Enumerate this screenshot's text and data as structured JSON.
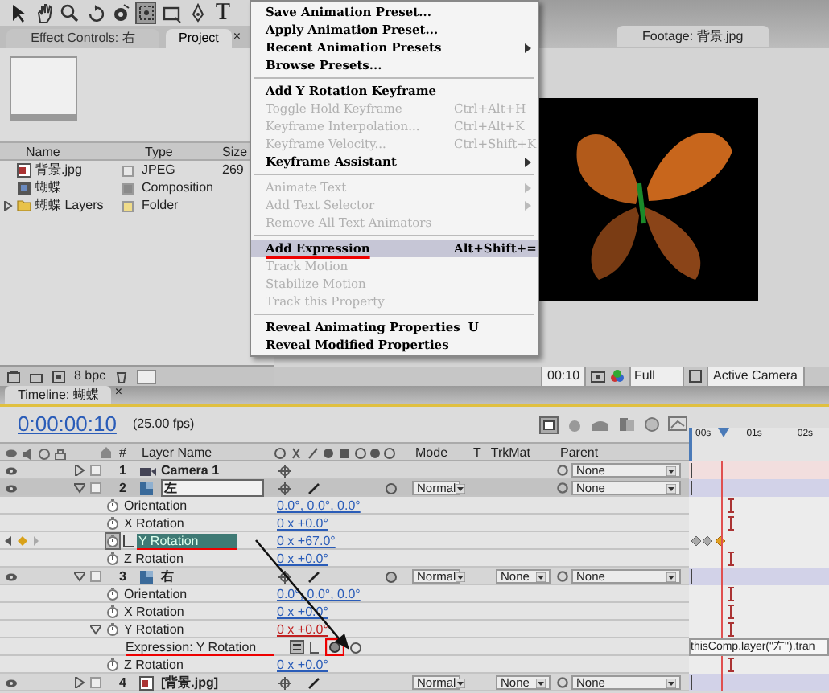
{
  "tools": [
    {
      "kind": "selection",
      "selected": false
    },
    {
      "kind": "hand",
      "selected": false
    },
    {
      "kind": "zoom",
      "selected": false
    },
    {
      "kind": "rotate",
      "selected": false
    },
    {
      "kind": "orbit",
      "selected": false
    },
    {
      "kind": "pan-behind",
      "selected": true
    },
    {
      "kind": "rectangle",
      "selected": false
    },
    {
      "kind": "pen",
      "selected": false
    },
    {
      "kind": "text",
      "label": "T",
      "selected": false
    }
  ],
  "left_panel": {
    "tabs": [
      {
        "label": "Effect Controls: 右",
        "selected": false
      },
      {
        "label": "Project",
        "close": "×",
        "selected": true
      }
    ],
    "columns": [
      "Name",
      "Type",
      "Size"
    ],
    "items": [
      {
        "kind": "footage",
        "name": "背景.jpg",
        "type": "JPEG",
        "size": "269"
      },
      {
        "kind": "composition",
        "name": "蝴蝶",
        "type": "Composition"
      },
      {
        "kind": "folder",
        "name": "蝴蝶 Layers",
        "type": "Folder",
        "expanded": false
      }
    ],
    "bit_depth": "8 bpc"
  },
  "context_menu": {
    "groups": [
      [
        {
          "label": "Save Animation Preset...",
          "disabled": false,
          "selected": false
        },
        {
          "label": "Apply Animation Preset...",
          "disabled": false,
          "selected": false
        },
        {
          "label": "Recent Animation Presets",
          "disabled": false,
          "submenu": true,
          "selected": false
        },
        {
          "label": "Browse Presets...",
          "disabled": false,
          "selected": false
        }
      ],
      [
        {
          "label": "Add Y Rotation Keyframe",
          "disabled": false,
          "selected": false
        },
        {
          "label": "Toggle Hold Keyframe",
          "shortcut": "Ctrl+Alt+H",
          "disabled": true,
          "selected": false
        },
        {
          "label": "Keyframe Interpolation...",
          "shortcut": "Ctrl+Alt+K",
          "disabled": true,
          "selected": false
        },
        {
          "label": "Keyframe Velocity...",
          "shortcut": "Ctrl+Shift+K",
          "disabled": true,
          "selected": false
        },
        {
          "label": "Keyframe Assistant",
          "disabled": false,
          "submenu": true,
          "selected": false
        }
      ],
      [
        {
          "label": "Animate Text",
          "disabled": true,
          "submenu": true,
          "selected": false
        },
        {
          "label": "Add Text Selector",
          "disabled": true,
          "submenu": true,
          "selected": false
        },
        {
          "label": "Remove All Text Animators",
          "disabled": true,
          "selected": false
        }
      ],
      [
        {
          "label": "Add Expression",
          "shortcut": "Alt+Shift+=",
          "disabled": false,
          "selected": true,
          "underlined": true
        },
        {
          "label": "Track Motion",
          "disabled": true,
          "selected": false
        },
        {
          "label": "Stabilize Motion",
          "disabled": true,
          "selected": false
        },
        {
          "label": "Track this Property",
          "disabled": true,
          "selected": false
        }
      ],
      [
        {
          "label": "Reveal Animating Properties",
          "shortcut": "U",
          "disabled": false,
          "selected": false
        },
        {
          "label": "Reveal Modified Properties",
          "disabled": false,
          "selected": false
        }
      ]
    ]
  },
  "viewer": {
    "tab": "Footage: 背景.jpg",
    "time": "00:10",
    "resolution": "Full",
    "view": "Active Camera"
  },
  "timeline": {
    "tab": "Timeline: 蝴蝶",
    "close": "×",
    "current_time": "0:00:00:10",
    "fps": "(25.00 fps)",
    "columns": {
      "number": "#",
      "layer_name": "Layer Name",
      "mode": "Mode",
      "t": "T",
      "trkmat": "TrkMat",
      "parent": "Parent"
    },
    "ruler": [
      "00s",
      "01s",
      "02s"
    ],
    "rows": [
      {
        "kind": "camera_layer",
        "number": "1",
        "name": "Camera 1",
        "expanded": false,
        "selected": false,
        "editing": false,
        "parent": "None"
      },
      {
        "kind": "solid_layer",
        "number": "2",
        "name": "左",
        "expanded": true,
        "selected": true,
        "editing": true,
        "mode": "Normal",
        "parent": "None"
      },
      {
        "kind": "property",
        "name": "Orientation",
        "value": "0.0°, 0.0°, 0.0°",
        "selected": false,
        "keyframes": false
      },
      {
        "kind": "property",
        "name": "X Rotation",
        "value": "0 x +0.0°",
        "selected": false,
        "keyframes": false
      },
      {
        "kind": "property",
        "name": "Y Rotation",
        "value": "0 x +67.0°",
        "selected": true,
        "keyframes": true,
        "underlined": true
      },
      {
        "kind": "property",
        "name": "Z Rotation",
        "value": "0 x +0.0°",
        "selected": false,
        "keyframes": false
      },
      {
        "kind": "solid_layer",
        "number": "3",
        "name": "右",
        "expanded": true,
        "selected": false,
        "editing": false,
        "mode": "Normal",
        "trkmat": "None",
        "parent": "None"
      },
      {
        "kind": "property",
        "name": "Orientation",
        "value": "0.0°, 0.0°, 0.0°",
        "selected": false,
        "keyframes": false
      },
      {
        "kind": "property",
        "name": "X Rotation",
        "value": "0 x +0.0°",
        "selected": false,
        "keyframes": false
      },
      {
        "kind": "property",
        "name": "Y Rotation",
        "value": "0 x +0.0°",
        "selected": false,
        "keyframes": false,
        "expression": true
      },
      {
        "kind": "expression",
        "name": "Expression: Y Rotation",
        "code": "thisComp.layer(\"左\").tran",
        "underlined": true
      },
      {
        "kind": "property",
        "name": "Z Rotation",
        "value": "0 x +0.0°",
        "selected": false,
        "keyframes": false
      },
      {
        "kind": "footage_layer",
        "number": "4",
        "name": "[背景.jpg]",
        "expanded": false,
        "selected": false,
        "editing": false,
        "mode": "Normal",
        "trkmat": "None",
        "parent": "None"
      }
    ]
  }
}
